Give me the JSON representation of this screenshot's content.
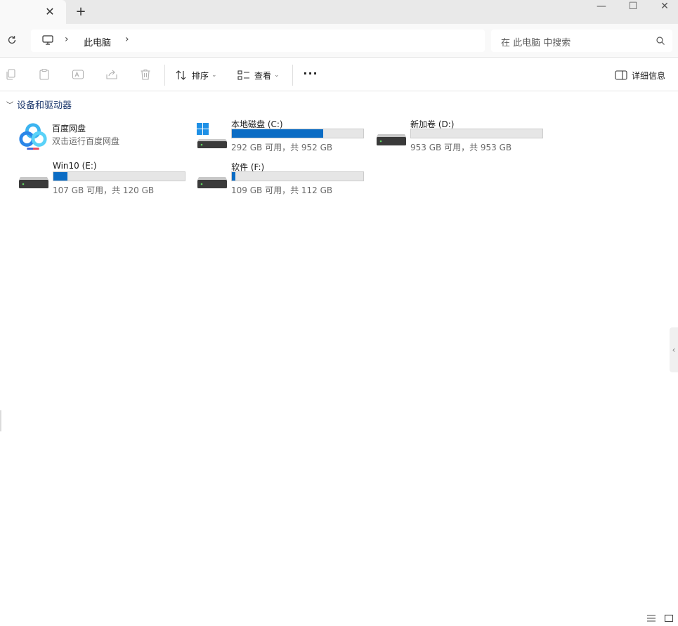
{
  "tab": {
    "close_glyph": "✕",
    "add_glyph": "+"
  },
  "window": {
    "minimize_glyph": "—",
    "maximize_glyph": "☐",
    "close_glyph": "✕"
  },
  "address": {
    "refresh_icon": "refresh-icon",
    "pc_icon": "computer-icon",
    "breadcrumb": [
      "此电脑"
    ],
    "sep_glyph": "›"
  },
  "search": {
    "placeholder": "在 此电脑 中搜索",
    "icon": "search-icon"
  },
  "commandbar": {
    "disabled_icons": [
      "copy-icon",
      "paste-icon",
      "rename-icon",
      "share-icon",
      "delete-icon"
    ],
    "sort_label": "排序",
    "view_label": "查看",
    "more_glyph": "···",
    "details_label": "详细信息"
  },
  "group": {
    "title": "设备和驱动器",
    "chevron": "﹀"
  },
  "app_item": {
    "name": "百度网盘",
    "subtitle": "双击运行百度网盘"
  },
  "drives": [
    {
      "name": "本地磁盘 (C:)",
      "space": "292 GB 可用，共 952 GB",
      "used_fraction": 0.693,
      "system": true
    },
    {
      "name": "新加卷 (D:)",
      "space": "953 GB 可用，共 953 GB",
      "used_fraction": 0.0,
      "system": false
    },
    {
      "name": "Win10 (E:)",
      "space": "107 GB 可用，共 120 GB",
      "used_fraction": 0.108,
      "system": false
    },
    {
      "name": "软件 (F:)",
      "space": "109 GB 可用，共 112 GB",
      "used_fraction": 0.027,
      "system": false
    }
  ],
  "colors": {
    "accent": "#0b6cc4",
    "bar_bg": "#e6e6e6",
    "group_header": "#1f3a6e"
  },
  "handle_glyph": "‹"
}
